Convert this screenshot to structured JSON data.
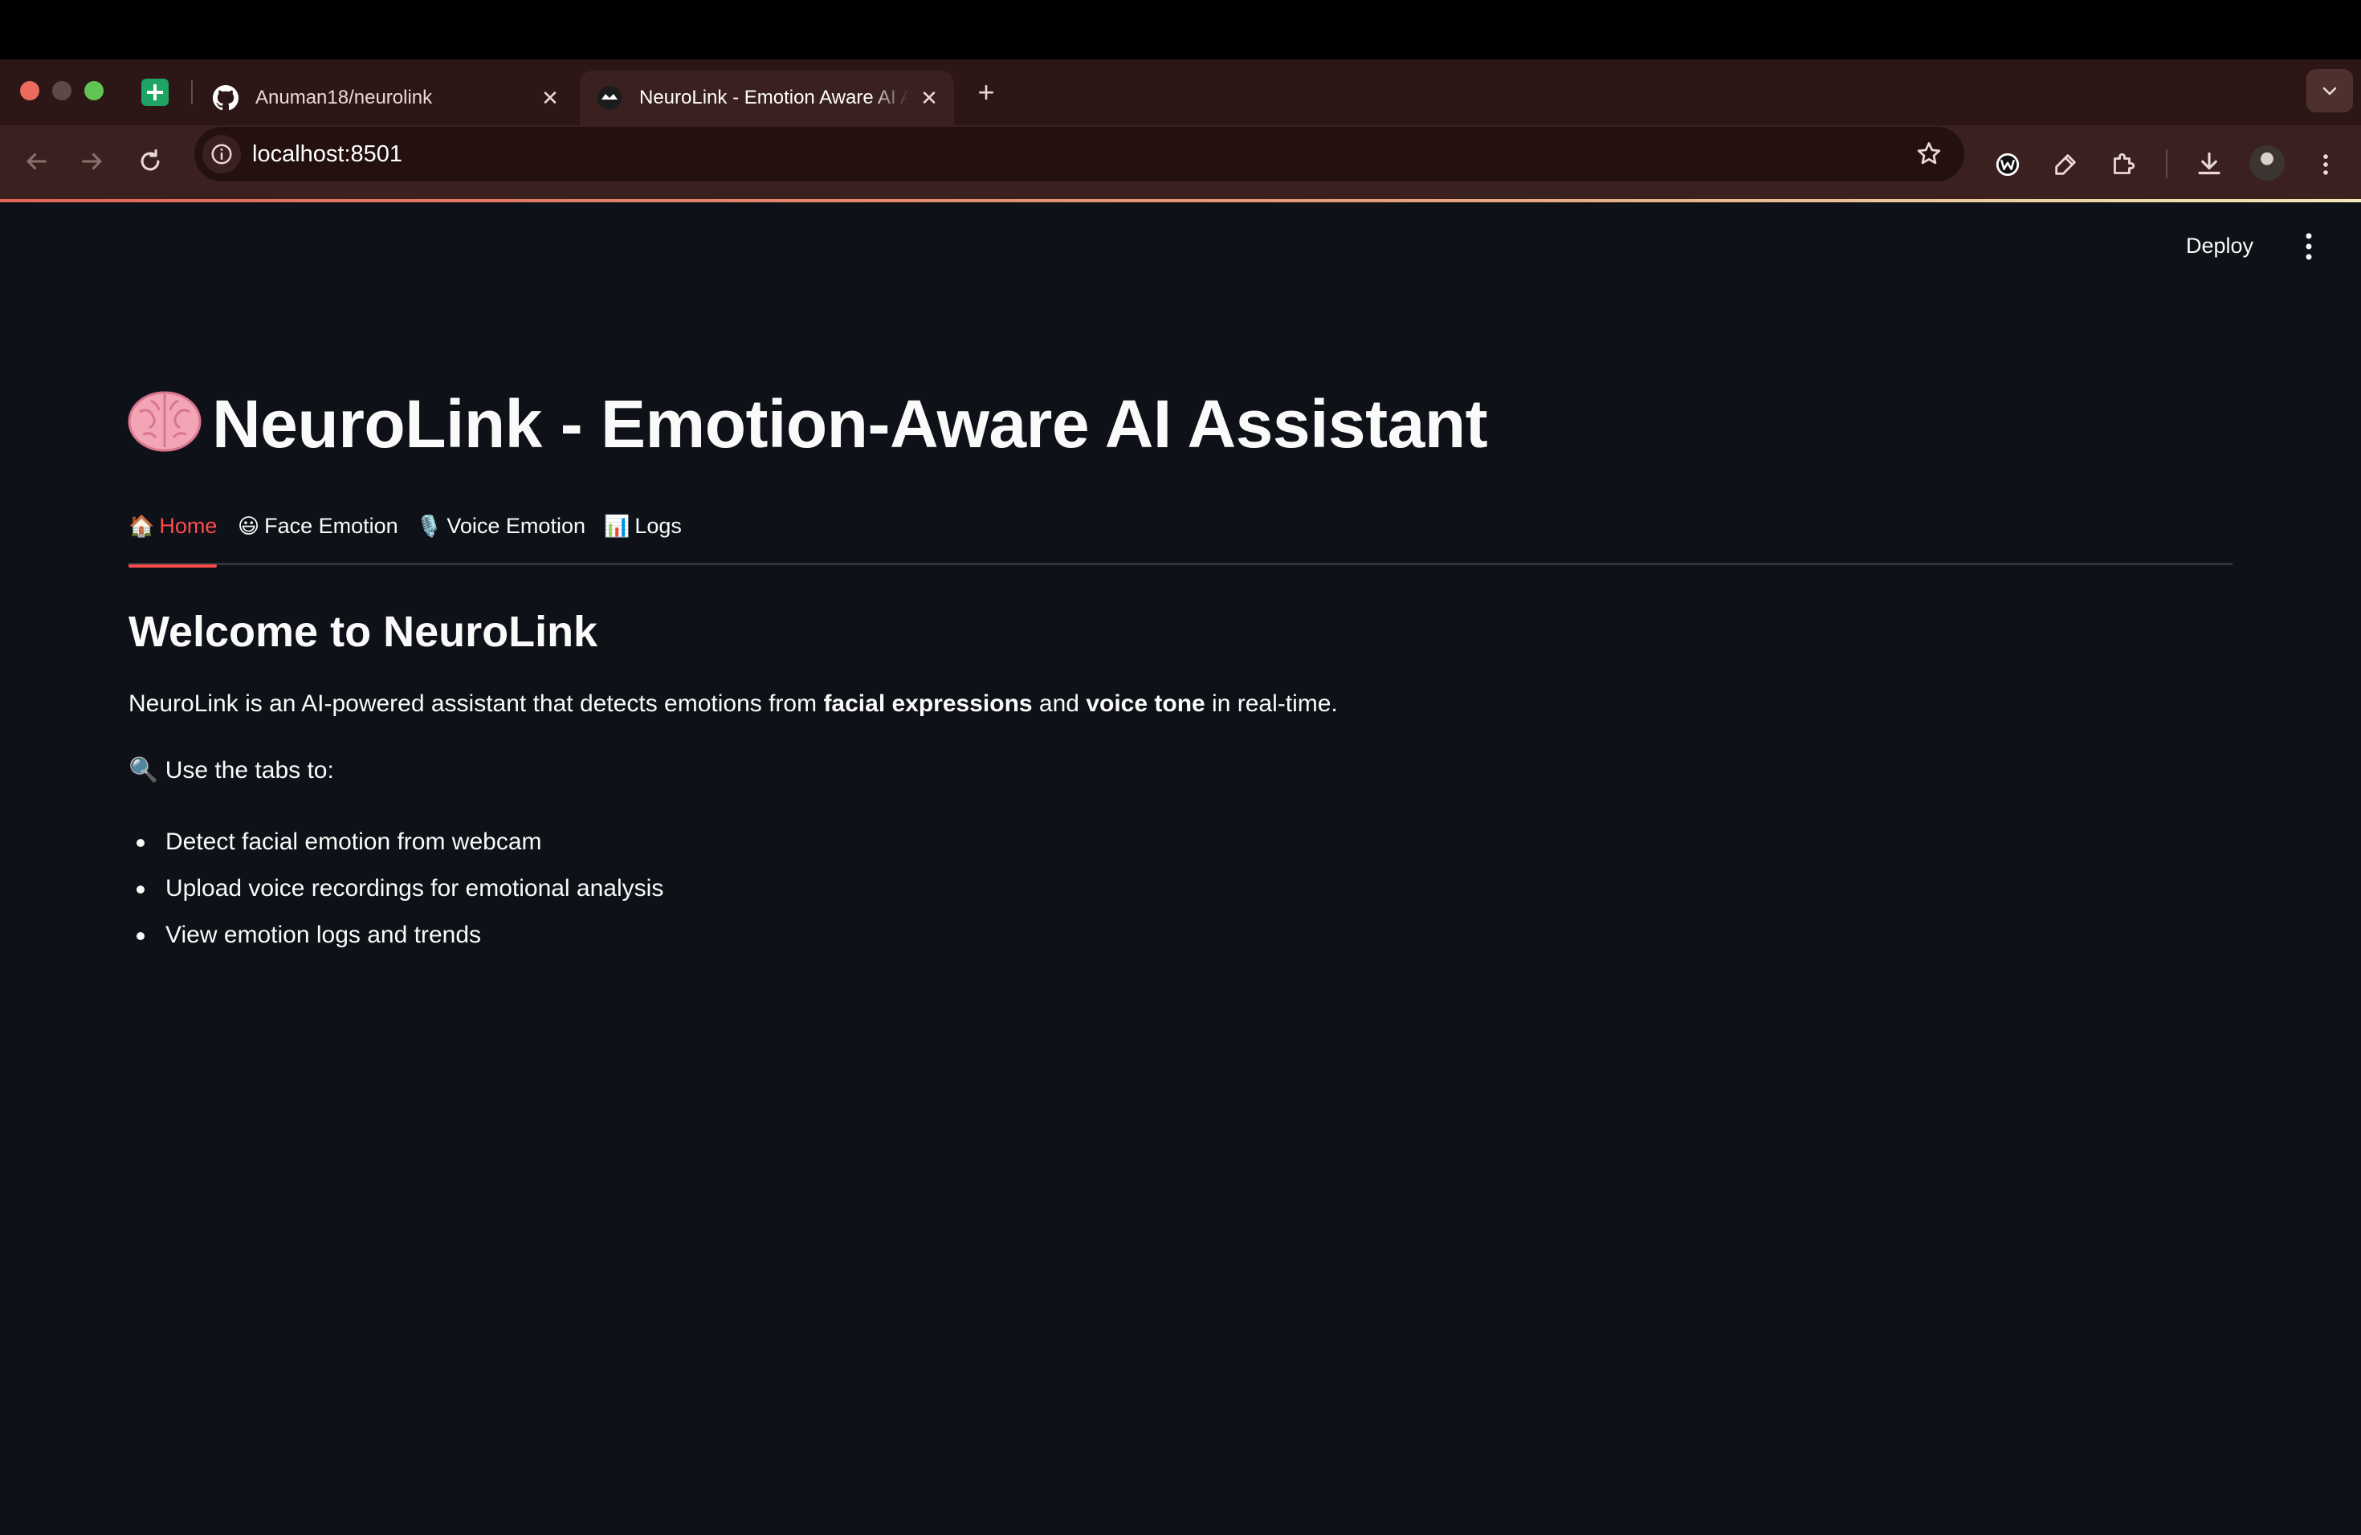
{
  "browser": {
    "tabs": [
      {
        "title": "Anuman18/neurolink",
        "icon": "github-icon",
        "active": false
      },
      {
        "title": "NeuroLink - Emotion Aware AI Assistant",
        "icon": "streamlit-icon",
        "active": true
      }
    ],
    "pinned_tab_icon": "google-sheets-icon",
    "url": "localhost:8501",
    "colors": {
      "chrome": "#3a201e",
      "tabstrip": "#2d1716",
      "omnibox": "#24110f"
    }
  },
  "app": {
    "deploy_label": "Deploy",
    "title_emoji": "🧠",
    "title": "NeuroLink - Emotion-Aware AI Assistant",
    "tabs": [
      {
        "emoji": "🏠",
        "label": "Home",
        "active": true
      },
      {
        "emoji": "😃",
        "label": "Face Emotion",
        "active": false
      },
      {
        "emoji": "🎙️",
        "label": "Voice Emotion",
        "active": false
      },
      {
        "emoji": "📊",
        "label": "Logs",
        "active": false
      }
    ],
    "heading": "Welcome to NeuroLink",
    "intro": {
      "part1": "NeuroLink is an AI-powered assistant that detects emotions from ",
      "bold1": "facial expressions",
      "part2": " and ",
      "bold2": "voice tone",
      "part3": " in real-time."
    },
    "use_tabs_emoji": "🔍",
    "use_tabs_text": "Use the tabs to:",
    "bullets": [
      "Detect facial emotion from webcam",
      "Upload voice recordings for emotional analysis",
      "View emotion logs and trends"
    ],
    "colors": {
      "background": "#0e1117",
      "text": "#fafafa",
      "accent": "#ff4b4b",
      "tab_border": "#31333f"
    }
  }
}
